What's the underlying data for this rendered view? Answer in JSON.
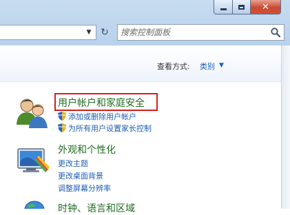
{
  "toolbar": {
    "search_placeholder": "搜索控制面板",
    "refresh_glyph": "↻"
  },
  "view": {
    "label": "查看方式:",
    "value": "类别"
  },
  "categories": [
    {
      "title": "用户帐户和家庭安全",
      "links": [
        "添加或删除用户帐户",
        "为所有用户设置家长控制"
      ],
      "icon": "users-icon"
    },
    {
      "title": "外观和个性化",
      "links": [
        "更改主题",
        "更改桌面背景",
        "调整屏幕分辨率"
      ],
      "icon": "appearance-icon"
    },
    {
      "title": "时钟、语言和区域",
      "links": [],
      "icon": "globe-clock-icon"
    }
  ],
  "colors": {
    "highlight": "#d21e1e",
    "title_green": "#1e6b1e",
    "link_blue": "#1e5eb5"
  }
}
